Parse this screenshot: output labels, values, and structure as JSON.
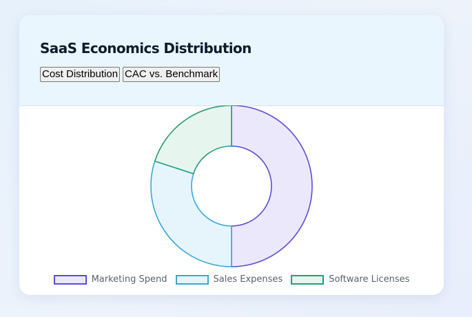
{
  "header": {
    "title": "SaaS Economics Distribution",
    "tabs": [
      "Cost Distribution",
      "CAC vs. Benchmark"
    ]
  },
  "chart_data": {
    "type": "pie",
    "variant": "doughnut",
    "title": "",
    "categories": [
      "Marketing Spend",
      "Sales Expenses",
      "Software Licenses"
    ],
    "values": [
      50,
      30,
      20
    ],
    "colors": {
      "stroke": [
        "#5b4bd9",
        "#3aa6dc",
        "#2a9a72"
      ],
      "fill": [
        "#ebe8fb",
        "#e6f5fc",
        "#e6f6ef"
      ]
    },
    "legend_position": "bottom"
  }
}
